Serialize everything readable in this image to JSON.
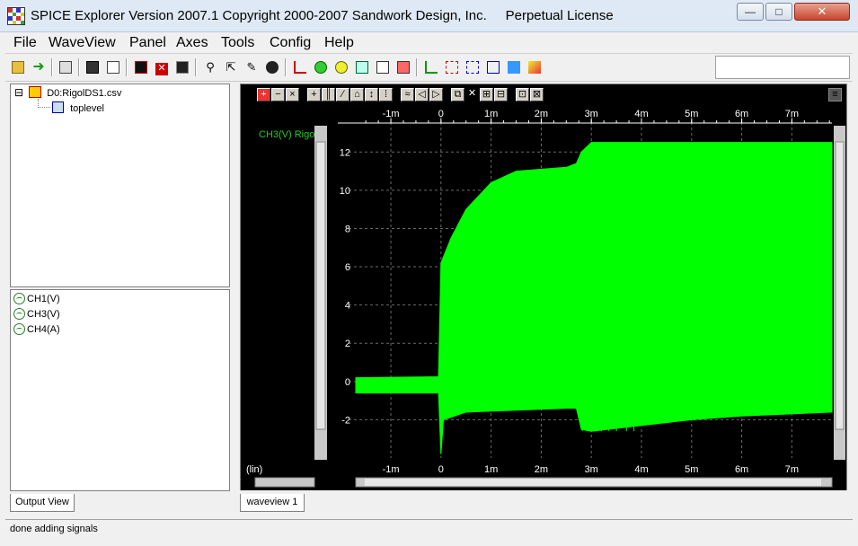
{
  "window": {
    "title": "SPICE Explorer Version 2007.1 Copyright 2000-2007 Sandwork Design, Inc.     Perpetual License",
    "minimize_label": "—",
    "maximize_label": "□",
    "close_label": "✕"
  },
  "menu": [
    "File",
    "WaveView",
    "Panel",
    "Axes",
    "Tools",
    "Config",
    "Help"
  ],
  "toolbar_icons": [
    "open-folder-icon",
    "arrow-right-icon",
    "print-icon",
    "save-icon",
    "open-icon",
    "chart-red-icon",
    "close-red-icon",
    "grid-icon",
    "zoom-icon",
    "cursor-icon",
    "pin-icon",
    "probe-icon",
    "measure-icon",
    "add-green-icon",
    "add-yellow-icon",
    "fit-icon",
    "layers-icon",
    "stack-icon",
    "histogram-icon",
    "marker-icon",
    "net-icon",
    "hier-icon",
    "fft-icon",
    "eye-icon"
  ],
  "tree": {
    "root_label": "D0:RigolDS1.csv",
    "child_label": "toplevel",
    "expand_symbol": "⊟"
  },
  "signals": [
    "CH1(V)",
    "CH3(V)",
    "CH4(A)"
  ],
  "tabs": {
    "output": "Output View",
    "waveview": "waveview 1"
  },
  "status": "done adding signals",
  "colors": {
    "trace": "#00ff00",
    "signal_label": "#22cc22",
    "grid": "#6a6a6a",
    "axis_text": "#ffffff",
    "background": "#000000"
  },
  "chart_data": {
    "type": "line",
    "series": [
      {
        "name": "CH3(V) Rigo",
        "upper_envelope": [
          [
            -1.7,
            0.2
          ],
          [
            -0.05,
            0.25
          ],
          [
            0.0,
            6.2
          ],
          [
            0.2,
            7.5
          ],
          [
            0.5,
            9.0
          ],
          [
            1.0,
            10.4
          ],
          [
            1.5,
            11.0
          ],
          [
            2.5,
            11.2
          ],
          [
            2.7,
            11.4
          ],
          [
            2.8,
            12.0
          ],
          [
            3.0,
            12.5
          ],
          [
            7.8,
            12.5
          ]
        ],
        "lower_envelope": [
          [
            -1.7,
            -0.6
          ],
          [
            -0.05,
            -0.6
          ],
          [
            0.0,
            -3.8
          ],
          [
            0.05,
            -2.0
          ],
          [
            0.5,
            -1.6
          ],
          [
            1.5,
            -1.5
          ],
          [
            2.5,
            -1.4
          ],
          [
            2.7,
            -1.4
          ],
          [
            2.8,
            -2.5
          ],
          [
            3.0,
            -2.6
          ],
          [
            4.0,
            -2.3
          ],
          [
            5.0,
            -2.0
          ],
          [
            6.0,
            -1.8
          ],
          [
            7.8,
            -1.6
          ]
        ]
      }
    ],
    "series_label": "CH3(V) Rigo",
    "xlabel": "(lin)",
    "x_unit": "ms",
    "x_ticks": [
      "-1m",
      "0",
      "1m",
      "2m",
      "3m",
      "4m",
      "5m",
      "6m",
      "7m"
    ],
    "x_tick_values": [
      -1,
      0,
      1,
      2,
      3,
      4,
      5,
      6,
      7
    ],
    "xlim": [
      -1.7,
      7.8
    ],
    "y_ticks": [
      "12",
      "10",
      "8",
      "6",
      "4",
      "2",
      "0",
      "-2"
    ],
    "y_tick_values": [
      12,
      10,
      8,
      6,
      4,
      2,
      0,
      -2
    ],
    "ylim": [
      -4,
      13
    ],
    "grid": true
  }
}
